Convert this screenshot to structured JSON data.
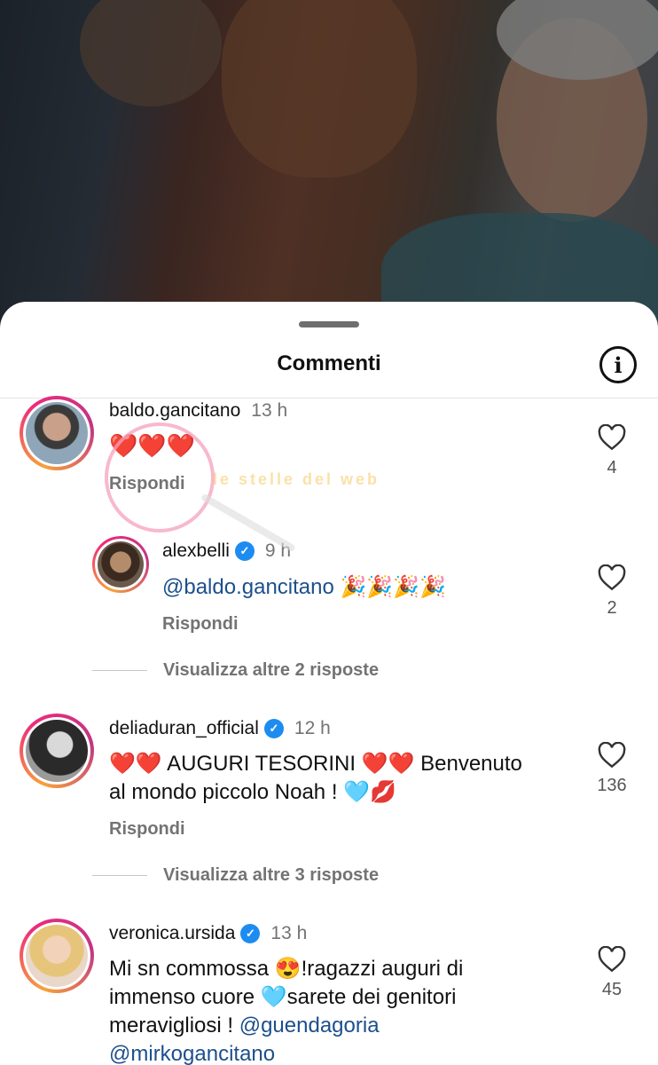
{
  "sheet": {
    "title": "Commenti"
  },
  "comments": [
    {
      "username": "baldo.gancitano",
      "time": "13 h",
      "verified": false,
      "text": "❤️❤️❤️",
      "reply_label": "Rispondi",
      "likes": "4",
      "avatar": "baldo-avatar"
    },
    {
      "username": "alexbelli",
      "time": "9 h",
      "verified": true,
      "mention": "@baldo.gancitano",
      "text": "🎉🎉🎉🎉",
      "reply_label": "Rispondi",
      "likes": "2",
      "avatar": "alexbelli-avatar"
    },
    {
      "username": "deliaduran_official",
      "time": "12 h",
      "verified": true,
      "text_line1": "❤️❤️ AUGURI TESORINI ❤️❤️ Benvenuto",
      "text_line2": "al mondo piccolo Noah ! 🩵💋",
      "reply_label": "Rispondi",
      "likes": "136",
      "avatar": "delia-avatar"
    },
    {
      "username": "veronica.ursida",
      "time": "13 h",
      "verified": true,
      "text_line1": "Mi sn commossa 😍!ragazzi auguri di",
      "text_line2": "immenso cuore 🩵sarete dei genitori",
      "text_line3_plain": "meravigliosi !",
      "text_line3_mention": "@guendagoria",
      "text_line4_mention": "@mirkogancitano",
      "likes": "45",
      "avatar": "veronica-avatar"
    }
  ],
  "threads": [
    {
      "label": "Visualizza altre 2 risposte"
    },
    {
      "label": "Visualizza altre 3 risposte"
    }
  ],
  "watermark": {
    "text": "le stelle del web"
  },
  "icons": {
    "info": "info-icon",
    "like": "heart-outline-icon",
    "verified": "verified-badge-icon"
  },
  "colors": {
    "verified": "#1d8cf0",
    "mention": "#1c4f8c",
    "secondary_text": "#737373"
  }
}
